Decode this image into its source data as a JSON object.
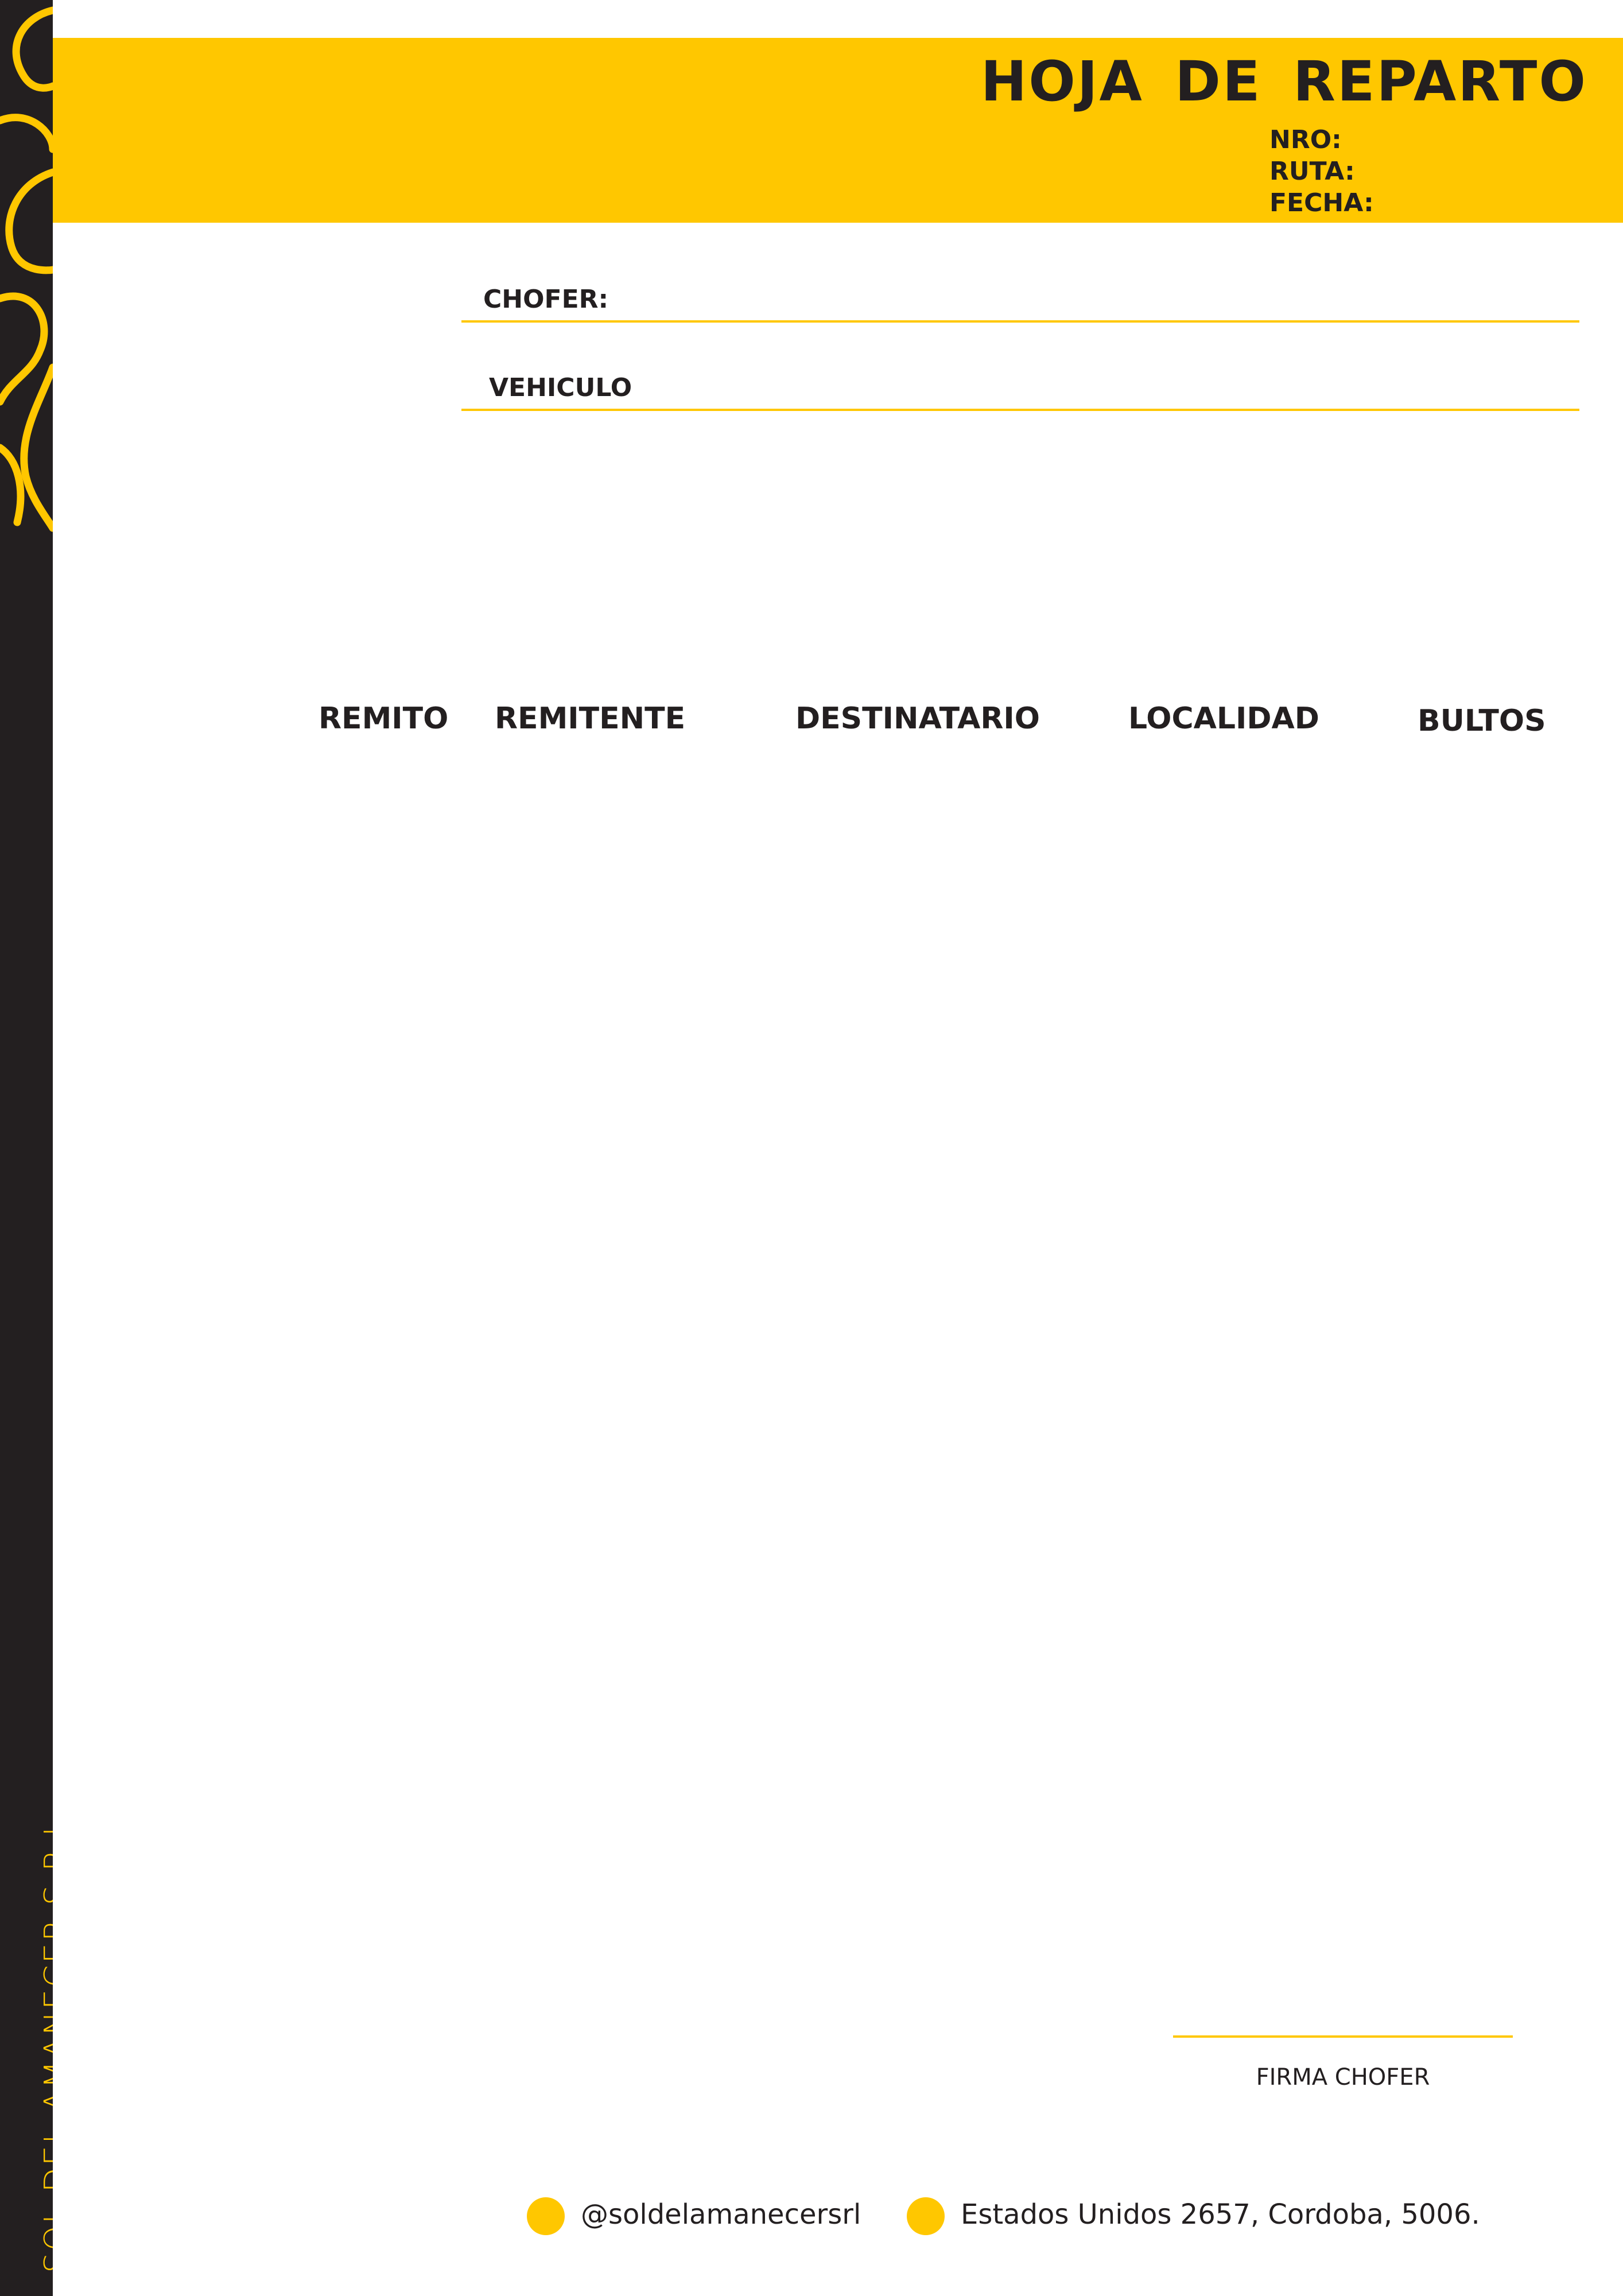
{
  "brand": {
    "name": "SOL DEL AMANECER S.R.L.",
    "accent_color": "#ffc700",
    "sidebar_color": "#231f20"
  },
  "header": {
    "title": "HOJA  DE  REPARTO",
    "meta": [
      "NRO:",
      "RUTA:",
      "FECHA:"
    ]
  },
  "fields": {
    "driver_label": "CHOFER:",
    "vehicle_label": "VEHICULO"
  },
  "table": {
    "columns": [
      "REMITO",
      "REMITENTE",
      "DESTINATARIO",
      "LOCALIDAD",
      "BULTOS"
    ],
    "rows": []
  },
  "signature": {
    "label": "FIRMA CHOFER"
  },
  "footer": {
    "social_handle": "@soldelamanecersrl",
    "address": "Estados Unidos 2657, Cordoba, 5006.",
    "icons": [
      "bullet-dot-icon",
      "bullet-dot-icon"
    ]
  }
}
